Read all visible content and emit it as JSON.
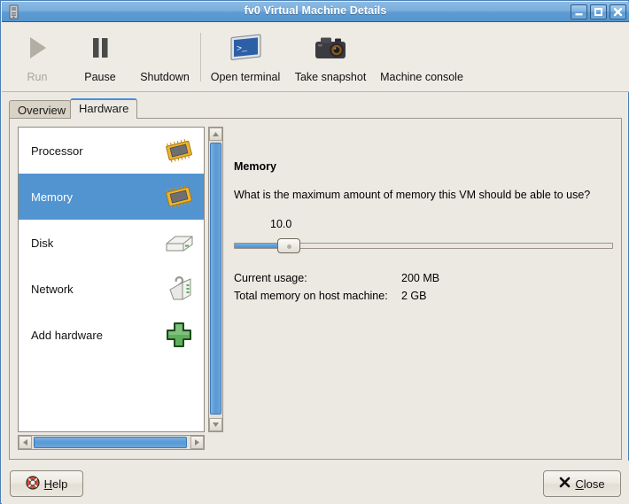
{
  "window": {
    "title": "fv0 Virtual Machine Details",
    "icon": "computer-tower-icon",
    "controls": {
      "minimize": "minimize-icon",
      "maximize": "maximize-icon",
      "close": "close-icon"
    }
  },
  "toolbar": {
    "items": [
      {
        "label": "Run",
        "icon": "play-icon",
        "disabled": true
      },
      {
        "label": "Pause",
        "icon": "pause-icon",
        "disabled": false
      },
      {
        "label": "Shutdown",
        "icon": "shutdown-icon",
        "disabled": false
      },
      {
        "label": "Open terminal",
        "icon": "terminal-icon",
        "disabled": false
      },
      {
        "label": "Take snapshot",
        "icon": "camera-icon",
        "disabled": false
      },
      {
        "label": "Machine console",
        "icon": "console-icon",
        "disabled": false
      }
    ]
  },
  "tabs": [
    {
      "label": "Overview",
      "active": false
    },
    {
      "label": "Hardware",
      "active": true
    }
  ],
  "hardware_list": {
    "items": [
      {
        "label": "Processor",
        "icon": "cpu-chip-icon",
        "selected": false
      },
      {
        "label": "Memory",
        "icon": "memory-chip-icon",
        "selected": true
      },
      {
        "label": "Disk",
        "icon": "hard-disk-icon",
        "selected": false
      },
      {
        "label": "Network",
        "icon": "network-plug-icon",
        "selected": false
      },
      {
        "label": "Add hardware",
        "icon": "green-plus-icon",
        "selected": false
      }
    ]
  },
  "detail": {
    "title": "Memory",
    "question": "What is the maximum amount of memory this VM should be able to use?",
    "slider": {
      "value": "10.0",
      "fill_percent": 12
    },
    "rows": [
      {
        "label": "Current usage:",
        "value": "200 MB"
      },
      {
        "label": "Total memory on host machine:",
        "value": "2 GB"
      }
    ]
  },
  "actions": {
    "help": {
      "label_before": "",
      "label_accel": "H",
      "label_after": "elp",
      "icon": "lifebuoy-help-icon"
    },
    "close": {
      "label_before": "",
      "label_accel": "C",
      "label_after": "lose",
      "icon": "x-mark-icon"
    }
  },
  "colors": {
    "title_bar_blue": "#5e9bd3",
    "selection_blue": "#5294d0",
    "scrollbar_blue": "#5d9bd6",
    "window_bg": "#ece9e2",
    "accent_tab": "#4a90d9"
  }
}
